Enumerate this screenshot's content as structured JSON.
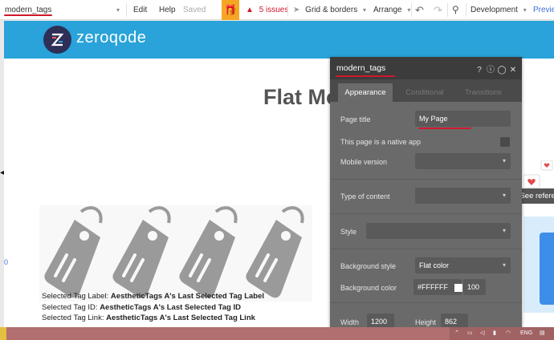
{
  "toolbar": {
    "page_name": "modern_tags",
    "edit_label": "Edit",
    "help_label": "Help",
    "saved_label": "Saved",
    "issues_label": "5 issues",
    "grid_label": "Grid & borders",
    "arrange_label": "Arrange",
    "env_label": "Development",
    "preview_label": "Preview"
  },
  "canvas": {
    "logo_text": "zeroqode",
    "heading": "Flat Mo",
    "info_lines": [
      {
        "label": "Selected Tag Label: ",
        "value": "AestheticTags A's Last Selected Tag Label"
      },
      {
        "label": "Selected Tag ID: ",
        "value": "AestheticTags A's Last Selected Tag ID"
      },
      {
        "label": "Selected Tag Link: ",
        "value": "AestheticTags A's Last Selected Tag Link"
      }
    ],
    "see_reference": "See refere"
  },
  "panel": {
    "title": "modern_tags",
    "tabs": [
      "Appearance",
      "Conditional",
      "Transitions"
    ],
    "page_title_label": "Page title",
    "page_title_value": "My Page",
    "native_app_label": "This page is a native app",
    "mobile_version_label": "Mobile version",
    "type_of_content_label": "Type of content",
    "style_label": "Style",
    "bg_style_label": "Background style",
    "bg_style_value": "Flat color",
    "bg_color_label": "Background color",
    "bg_color_value": "#FFFFFF",
    "bg_opacity_value": "100",
    "width_label": "Width",
    "width_value": "1200",
    "height_label": "Height",
    "height_value": "862"
  },
  "taskbar": {
    "lang": "ENG"
  },
  "colors": {
    "banner": "#29a3d9",
    "accent_red": "#d0182e",
    "gift": "#f5a623",
    "panel_bg": "#6a6a6a"
  }
}
